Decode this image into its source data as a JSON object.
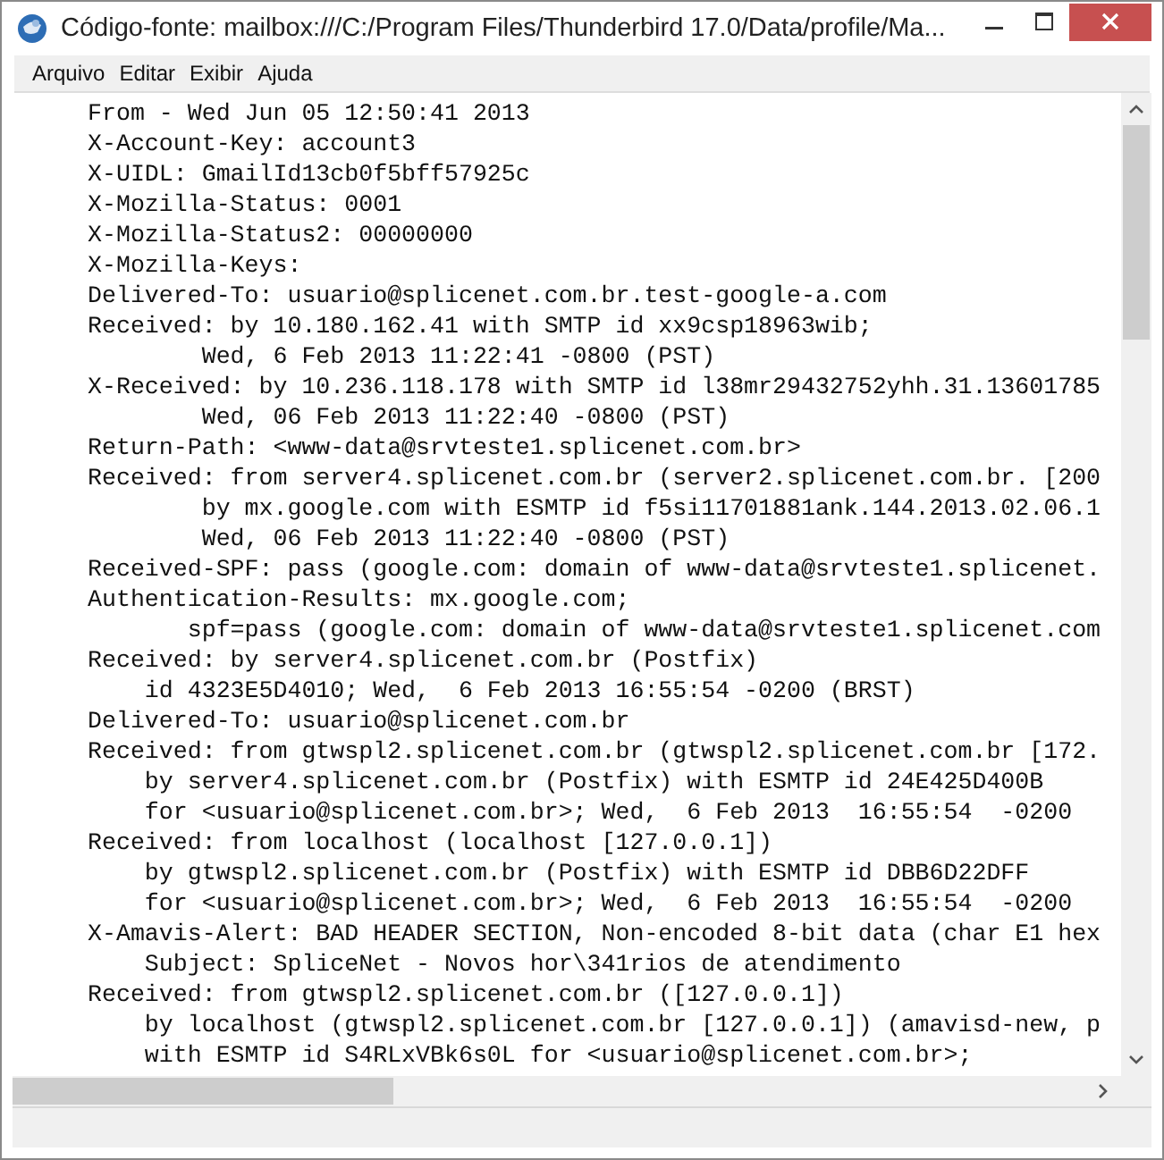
{
  "window": {
    "title": "Código-fonte: mailbox:///C:/Program Files/Thunderbird 17.0/Data/profile/Ma..."
  },
  "menu": [
    {
      "label": "Arquivo"
    },
    {
      "label": "Editar"
    },
    {
      "label": "Exibir"
    },
    {
      "label": "Ajuda"
    }
  ],
  "source_lines": [
    "From - Wed Jun 05 12:50:41 2013",
    "X-Account-Key: account3",
    "X-UIDL: GmailId13cb0f5bff57925c",
    "X-Mozilla-Status: 0001",
    "X-Mozilla-Status2: 00000000",
    "X-Mozilla-Keys:",
    "Delivered-To: usuario@splicenet.com.br.test-google-a.com",
    "Received: by 10.180.162.41 with SMTP id xx9csp18963wib;",
    "        Wed, 6 Feb 2013 11:22:41 -0800 (PST)",
    "X-Received: by 10.236.118.178 with SMTP id l38mr29432752yhh.31.13601785",
    "        Wed, 06 Feb 2013 11:22:40 -0800 (PST)",
    "Return-Path: <www-data@srvteste1.splicenet.com.br>",
    "Received: from server4.splicenet.com.br (server2.splicenet.com.br. [200",
    "        by mx.google.com with ESMTP id f5si11701881ank.144.2013.02.06.1",
    "        Wed, 06 Feb 2013 11:22:40 -0800 (PST)",
    "Received-SPF: pass (google.com: domain of www-data@srvteste1.splicenet.",
    "Authentication-Results: mx.google.com;",
    "       spf=pass (google.com: domain of www-data@srvteste1.splicenet.com",
    "Received: by server4.splicenet.com.br (Postfix)",
    "    id 4323E5D4010; Wed,  6 Feb 2013 16:55:54 -0200 (BRST)",
    "Delivered-To: usuario@splicenet.com.br",
    "Received: from gtwspl2.splicenet.com.br (gtwspl2.splicenet.com.br [172.",
    "    by server4.splicenet.com.br (Postfix) with ESMTP id 24E425D400B",
    "    for <usuario@splicenet.com.br>; Wed,  6 Feb 2013  16:55:54  -0200",
    "Received: from localhost (localhost [127.0.0.1])",
    "    by gtwspl2.splicenet.com.br (Postfix) with ESMTP id DBB6D22DFF",
    "    for <usuario@splicenet.com.br>; Wed,  6 Feb 2013  16:55:54  -0200",
    "X-Amavis-Alert: BAD HEADER SECTION, Non-encoded 8-bit data (char E1 hex",
    "    Subject: SpliceNet - Novos hor\\341rios de atendimento",
    "Received: from gtwspl2.splicenet.com.br ([127.0.0.1])",
    "    by localhost (gtwspl2.splicenet.com.br [127.0.0.1]) (amavisd-new, p",
    "    with ESMTP id S4RLxVBk6s0L for <usuario@splicenet.com.br>;"
  ]
}
